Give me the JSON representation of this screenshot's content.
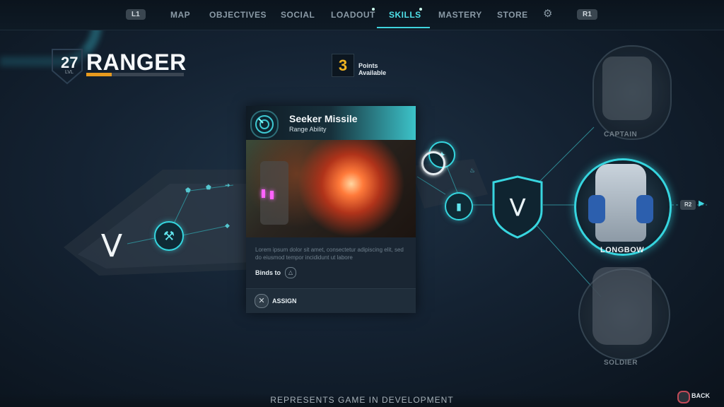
{
  "nav": {
    "l1": "L1",
    "r1": "R1",
    "items": [
      "MAP",
      "OBJECTIVES",
      "SOCIAL",
      "LOADOUT",
      "SKILLS",
      "MASTERY",
      "STORE"
    ],
    "active": "SKILLS"
  },
  "player": {
    "level": "27",
    "level_label": "LVL",
    "class_name": "RANGER",
    "xp_progress": 0.26
  },
  "points": {
    "value": "3",
    "label": "Points Available"
  },
  "skill_card": {
    "title": "Seeker Missile",
    "subtitle": "Range Ability",
    "description": "Lorem ipsum dolor sit amet, consectetur adipiscing elit, sed do eiusmod tempor incididunt ut labore",
    "binds_label": "Binds to",
    "binds_icon": "triangle-icon",
    "assign_label": "ASSIGN",
    "assign_icon": "cross-icon"
  },
  "characters": {
    "top": "CAPTAIN",
    "selected": "LONGBOW",
    "bottom": "SOLDIER"
  },
  "r2": "R2",
  "footer": {
    "notice": "REPRESENTS GAME IN DEVELOPMENT",
    "back_label": "BACK"
  },
  "colors": {
    "accent": "#3fd4de",
    "xp": "#e79a1e",
    "points": "#f0b421"
  }
}
